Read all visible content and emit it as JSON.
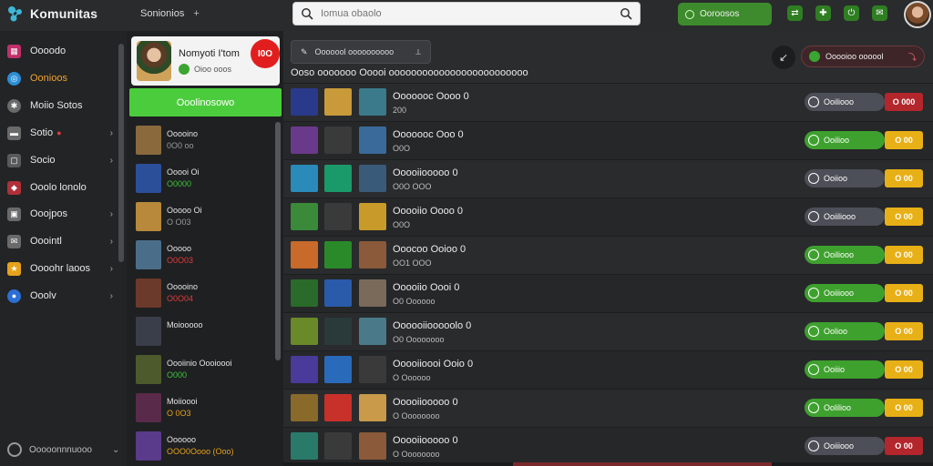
{
  "app": {
    "title": "Komunitas"
  },
  "top_nav": {
    "label": "Sonionios",
    "plus": "+"
  },
  "search": {
    "placeholder": "Iomua obaolo"
  },
  "status_button": {
    "label": "Ooroosos"
  },
  "top_icons": [
    "shuffle-icon",
    "gamepad-icon",
    "power-icon",
    "chat-icon"
  ],
  "sidebar": {
    "items": [
      {
        "label": "Oooodo",
        "icon": "grid-icon",
        "color": "#c0306a",
        "chevron": false,
        "active": false
      },
      {
        "label": "Oonioos",
        "icon": "compass-icon",
        "color": "#2b8fd6",
        "chevron": false,
        "active": true
      },
      {
        "label": "Moiio Sotos",
        "icon": "puzzle-icon",
        "color": "#6a6a6a",
        "chevron": false,
        "active": false
      },
      {
        "label": "Sotio",
        "icon": "panel-icon",
        "color": "#6a6a6a",
        "chevron": true,
        "active": false,
        "dot": true
      },
      {
        "label": "Socio",
        "icon": "box-icon",
        "color": "#5a5a5a",
        "chevron": true,
        "active": false
      },
      {
        "label": "Ooolo lonolo",
        "icon": "bookmark-icon",
        "color": "#b0303a",
        "chevron": false,
        "active": false
      },
      {
        "label": "Ooojpos",
        "icon": "image-icon",
        "color": "#6a6a6a",
        "chevron": true,
        "active": false
      },
      {
        "label": "Ooointl",
        "icon": "mail-icon",
        "color": "#6a6a6a",
        "chevron": true,
        "active": false
      },
      {
        "label": "Oooohr laoos",
        "icon": "star-icon",
        "color": "#e6a21a",
        "chevron": true,
        "active": false
      },
      {
        "label": "Ooolv",
        "icon": "globe-icon",
        "color": "#2b6fd6",
        "chevron": true,
        "active": false
      }
    ],
    "footer": "Ooooonnnuooo"
  },
  "profile": {
    "name": "Nomyoti I'tom",
    "status": "Oioo ooos",
    "badge": "I0O"
  },
  "add_friend": {
    "label": "Ooolinosowo"
  },
  "friends": [
    {
      "name": "Ooooino",
      "status": "0O0 oo",
      "status_color": "#9a9a9a",
      "avatar": "#8a6a3c"
    },
    {
      "name": "Ooooi Oi",
      "status": "O0000",
      "status_color": "#3cc43c",
      "avatar": "#2c4f9a"
    },
    {
      "name": "Ooooo Oi",
      "status": "O O03",
      "status_color": "#9a9a9a",
      "avatar": "#b8893a"
    },
    {
      "name": "Ooooo",
      "status": "O0O03",
      "status_color": "#e23a3a",
      "avatar": "#4a6e8a"
    },
    {
      "name": "Ooooino",
      "status": "O0O04",
      "status_color": "#e23a3a",
      "avatar": "#6b3a2a"
    },
    {
      "name": "Moiooooo",
      "status": "",
      "status_color": "#9a9a9a",
      "avatar": "#3a3d4a"
    },
    {
      "name": "Oooiinio Oooioooi",
      "status": "O000",
      "status_color": "#3cc43c",
      "avatar": "#4d5a2c"
    },
    {
      "name": "Moiioooi",
      "status": "O 0O3",
      "status_color": "#e6a21a",
      "avatar": "#5a2a4a"
    },
    {
      "name": "Oooooo",
      "status": "OOO0Oooo (Ooo)",
      "status_color": "#e6a21a",
      "avatar": "#5a3a8a"
    }
  ],
  "main": {
    "filter": "Ooooool oooooooooo",
    "filter_icon": "pin-icon",
    "activity": "Ooooioo oooool",
    "heading": "Ooso ooooooo Ooooi ooooooooooooooooooooooooo",
    "rows": [
      {
        "title": "Ooooooc Oooo 0",
        "sub": "200",
        "action": "Ooiliooo",
        "action_style": "gray",
        "badge": "O 000",
        "badge_style": "red",
        "thumbs": [
          "#2a3a8a",
          "#c89a3a",
          "#3a7a8a"
        ]
      },
      {
        "title": "Ooooooc Ooo 0",
        "sub": "O0O",
        "action": "Ooilioo",
        "action_style": "green",
        "badge": "O 00",
        "badge_style": "yellow",
        "thumbs": [
          "#6a3a8a",
          "#3a3a3a",
          "#3a6a9a"
        ]
      },
      {
        "title": "Ooooiiooooo 0",
        "sub": "O0O OOO",
        "action": "Ooiioo",
        "action_style": "gray",
        "badge": "O 00",
        "badge_style": "yellow",
        "thumbs": [
          "#2a8aba",
          "#1a9a6a",
          "#3a5a7a"
        ]
      },
      {
        "title": "Ooooiio Oooo 0",
        "sub": "O0O",
        "action": "Ooiiliooo",
        "action_style": "gray",
        "badge": "O 00",
        "badge_style": "yellow",
        "thumbs": [
          "#3a8a3a",
          "#3a3a3a",
          "#c89a2a"
        ]
      },
      {
        "title": "Ooocoo Ooioo 0",
        "sub": "OO1 OOO",
        "action": "Ooiliooo",
        "action_style": "green",
        "badge": "O 00",
        "badge_style": "yellow",
        "thumbs": [
          "#c86a2a",
          "#2a8a2a",
          "#8a5a3a"
        ]
      },
      {
        "title": "Ooooiio Oooi 0",
        "sub": "O0 Oooooo",
        "action": "Ooiiiooo",
        "action_style": "green",
        "badge": "O 00",
        "badge_style": "yellow",
        "thumbs": [
          "#2a6a2a",
          "#2a5aaa",
          "#7a6a5a"
        ]
      },
      {
        "title": "Oooooiiooooolo 0",
        "sub": "O0 Oooooooo",
        "action": "Oolioo",
        "action_style": "green",
        "badge": "O 00",
        "badge_style": "yellow",
        "thumbs": [
          "#6a8a2a",
          "#2a3a3a",
          "#4a7a8a"
        ]
      },
      {
        "title": "Ooooiioooi Ooio 0",
        "sub": "O Oooooo",
        "action": "Ooiiio",
        "action_style": "green",
        "badge": "O 00",
        "badge_style": "yellow",
        "thumbs": [
          "#4a3a9a",
          "#2a6aba",
          "#3a3a3a"
        ]
      },
      {
        "title": "Ooooiiooooo 0",
        "sub": "O Oooooooo",
        "action": "Oolilioo",
        "action_style": "green",
        "badge": "O 00",
        "badge_style": "yellow",
        "thumbs": [
          "#8a6a2a",
          "#c8302a",
          "#c89a4a"
        ]
      },
      {
        "title": "Ooooiiooooo 0",
        "sub": "O Oooooooo",
        "action": "Ooiiiooo",
        "action_style": "gray",
        "badge": "O 00",
        "badge_style": "red",
        "thumbs": [
          "#2a7a6a",
          "#3a3a3a",
          "#8a5a3a"
        ]
      }
    ]
  }
}
